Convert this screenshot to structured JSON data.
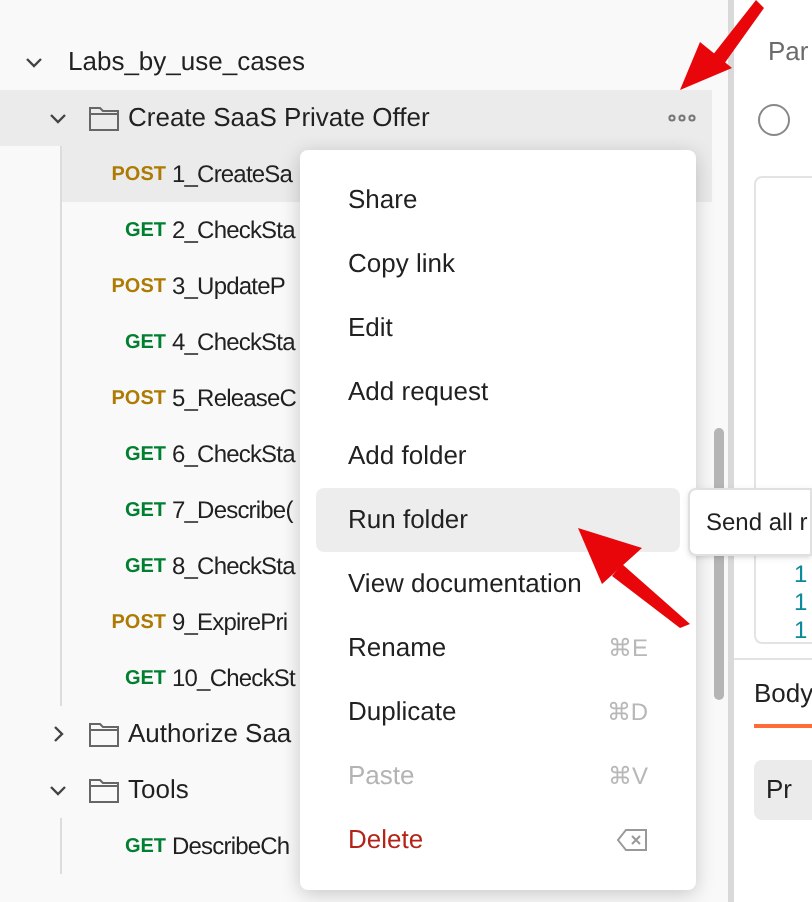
{
  "sidebar": {
    "tree": [
      {
        "kind": "folder",
        "label": "Labs_by_use_cases",
        "expanded": true,
        "hovered": false,
        "children": [
          {
            "kind": "folder",
            "label": "Create SaaS Private Offer",
            "expanded": true,
            "hovered": true,
            "children": [
              {
                "kind": "request",
                "method": "POST",
                "label": "1_CreateSa",
                "selected": true
              },
              {
                "kind": "request",
                "method": "GET",
                "label": "2_CheckSta",
                "selected": false
              },
              {
                "kind": "request",
                "method": "POST",
                "label": "3_UpdateP",
                "selected": false
              },
              {
                "kind": "request",
                "method": "GET",
                "label": "4_CheckSta",
                "selected": false
              },
              {
                "kind": "request",
                "method": "POST",
                "label": "5_ReleaseC",
                "selected": false
              },
              {
                "kind": "request",
                "method": "GET",
                "label": "6_CheckSta",
                "selected": false
              },
              {
                "kind": "request",
                "method": "GET",
                "label": "7_Describe(",
                "selected": false
              },
              {
                "kind": "request",
                "method": "GET",
                "label": "8_CheckSta",
                "selected": false
              },
              {
                "kind": "request",
                "method": "POST",
                "label": "9_ExpirePri",
                "selected": false
              },
              {
                "kind": "request",
                "method": "GET",
                "label": "10_CheckSt",
                "selected": false
              }
            ]
          },
          {
            "kind": "folder",
            "label": "Authorize Saa",
            "expanded": false,
            "hovered": false
          },
          {
            "kind": "folder",
            "label": "Tools",
            "expanded": true,
            "hovered": false,
            "children": [
              {
                "kind": "request",
                "method": "GET",
                "label": "DescribeCh",
                "selected": false
              }
            ]
          }
        ]
      }
    ]
  },
  "context_menu": {
    "items": [
      {
        "label": "Share",
        "kind": "normal",
        "disabled": false,
        "selected": false
      },
      {
        "label": "Copy link",
        "kind": "normal",
        "disabled": false,
        "selected": false
      },
      {
        "label": "Edit",
        "kind": "normal",
        "disabled": false,
        "selected": false
      },
      {
        "label": "Add request",
        "kind": "normal",
        "disabled": false,
        "selected": false
      },
      {
        "label": "Add folder",
        "kind": "normal",
        "disabled": false,
        "selected": false
      },
      {
        "label": "Run folder",
        "kind": "normal",
        "disabled": false,
        "selected": true
      },
      {
        "label": "View documentation",
        "kind": "normal",
        "disabled": false,
        "selected": false
      },
      {
        "label": "Rename",
        "shortcut": "⌘E",
        "kind": "normal",
        "disabled": false,
        "selected": false
      },
      {
        "label": "Duplicate",
        "shortcut": "⌘D",
        "kind": "normal",
        "disabled": false,
        "selected": false
      },
      {
        "label": "Paste",
        "shortcut": "⌘V",
        "kind": "normal",
        "disabled": true,
        "selected": false
      },
      {
        "label": "Delete",
        "kind": "danger",
        "disabled": false,
        "selected": false
      }
    ]
  },
  "tooltip": "Send all r",
  "request_pane": {
    "tab": "Par",
    "radio": {
      "checked": false
    },
    "line_numbers": [
      "1",
      "1",
      "1"
    ],
    "body_tab": "Body",
    "button": "Pr"
  }
}
